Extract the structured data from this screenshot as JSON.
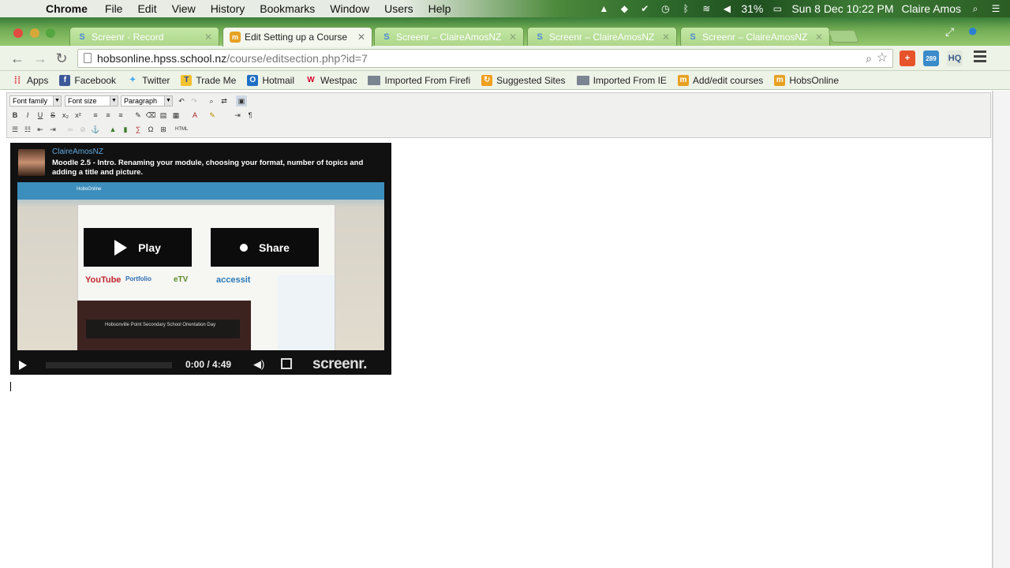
{
  "menubar": {
    "app_name": "Chrome",
    "menus": [
      "File",
      "Edit",
      "View",
      "History",
      "Bookmarks",
      "Window",
      "Users",
      "Help"
    ],
    "battery": "31%",
    "datetime": "Sun 8 Dec  10:22 PM",
    "user": "Claire Amos"
  },
  "tabs": [
    {
      "title": "Screenr - Record",
      "icon": "screenr-icon",
      "active": false
    },
    {
      "title": "Edit Setting up a Course",
      "icon": "moodle-icon",
      "active": true
    },
    {
      "title": "Screenr – ClaireAmosNZ",
      "icon": "screenr-icon",
      "active": false
    },
    {
      "title": "Screenr – ClaireAmosNZ",
      "icon": "screenr-icon",
      "active": false
    },
    {
      "title": "Screenr – ClaireAmosNZ",
      "icon": "screenr-icon",
      "active": false
    }
  ],
  "omnibox": {
    "host": "hobsonline.hpss.school.nz",
    "path": "/course/editsection.php?id=7"
  },
  "extensions": {
    "ext2_badge": "289",
    "ext3_label": "HQ"
  },
  "bookmarks": [
    {
      "label": "Apps"
    },
    {
      "label": "Facebook"
    },
    {
      "label": "Twitter"
    },
    {
      "label": "Trade Me"
    },
    {
      "label": "Hotmail"
    },
    {
      "label": "Westpac"
    },
    {
      "label": "Imported From Firefi"
    },
    {
      "label": "Suggested Sites"
    },
    {
      "label": "Imported From IE"
    },
    {
      "label": "Add/edit courses"
    },
    {
      "label": "HobsOnline"
    }
  ],
  "editor": {
    "font_family": "Font family",
    "font_size": "Font size",
    "format": "Paragraph"
  },
  "player": {
    "author": "ClaireAmosNZ",
    "title": "Moodle 2.5 - Intro. Renaming your module, choosing your format, number of topics and adding a title and picture.",
    "play_label": "Play",
    "share_label": "Share",
    "time": "0:00 / 4:49",
    "brand": "screenr.",
    "site_header": "HobsOnline",
    "notice_title": "Hobsonville Point Secondary School Orientation Day"
  }
}
